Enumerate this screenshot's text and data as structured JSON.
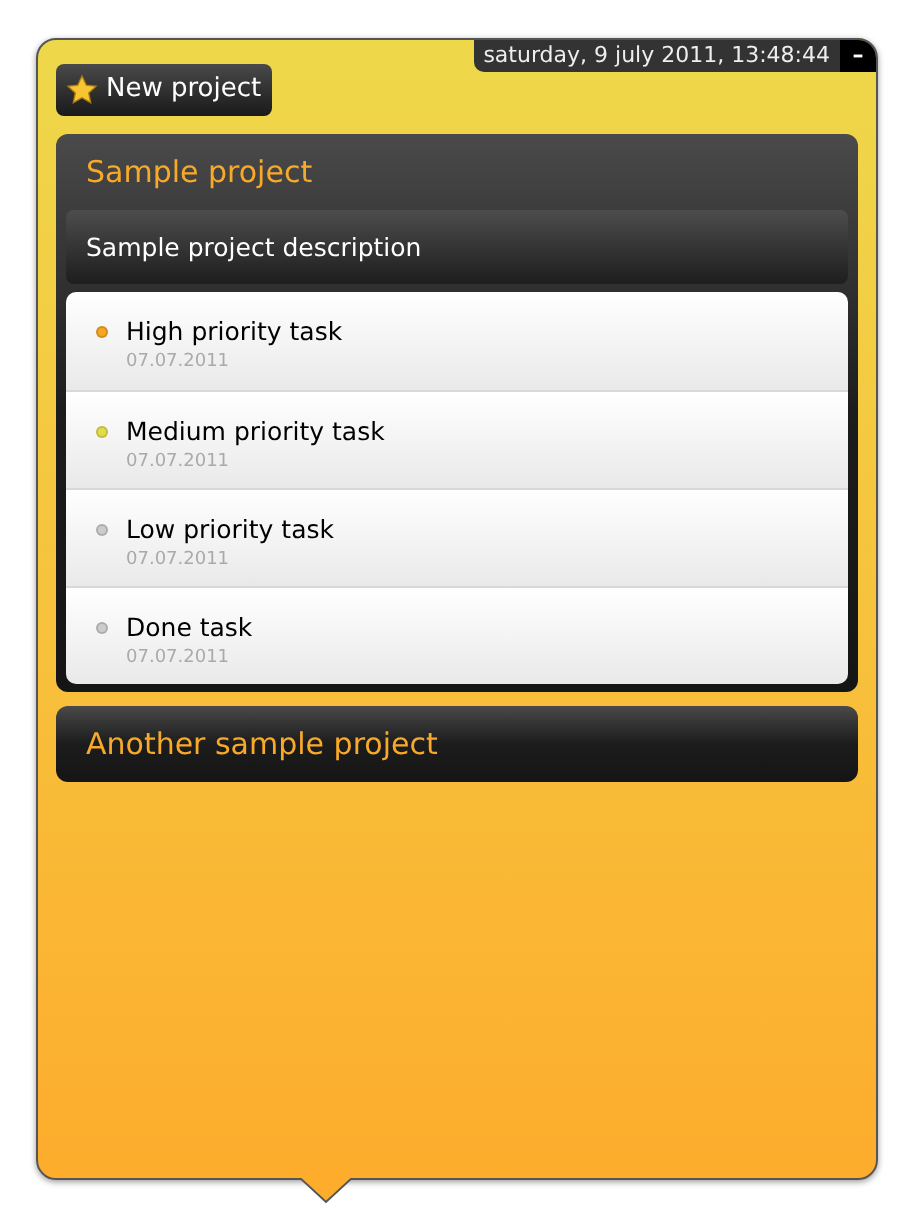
{
  "datetime": "saturday, 9 july 2011, 13:48:44",
  "minimize": "–",
  "new_project": {
    "label": "New project"
  },
  "projects": [
    {
      "title": "Sample project",
      "expanded": true,
      "description": "Sample project description",
      "tasks": [
        {
          "title": "High priority task",
          "date": "07.07.2011",
          "color": "#f5a623"
        },
        {
          "title": "Medium priority task",
          "date": "07.07.2011",
          "color": "#e3dc4a"
        },
        {
          "title": "Low priority task",
          "date": "07.07.2011",
          "color": "#cccccc"
        },
        {
          "title": "Done task",
          "date": "07.07.2011",
          "color": "#cccccc"
        }
      ]
    },
    {
      "title": "Another sample project",
      "expanded": false
    }
  ]
}
